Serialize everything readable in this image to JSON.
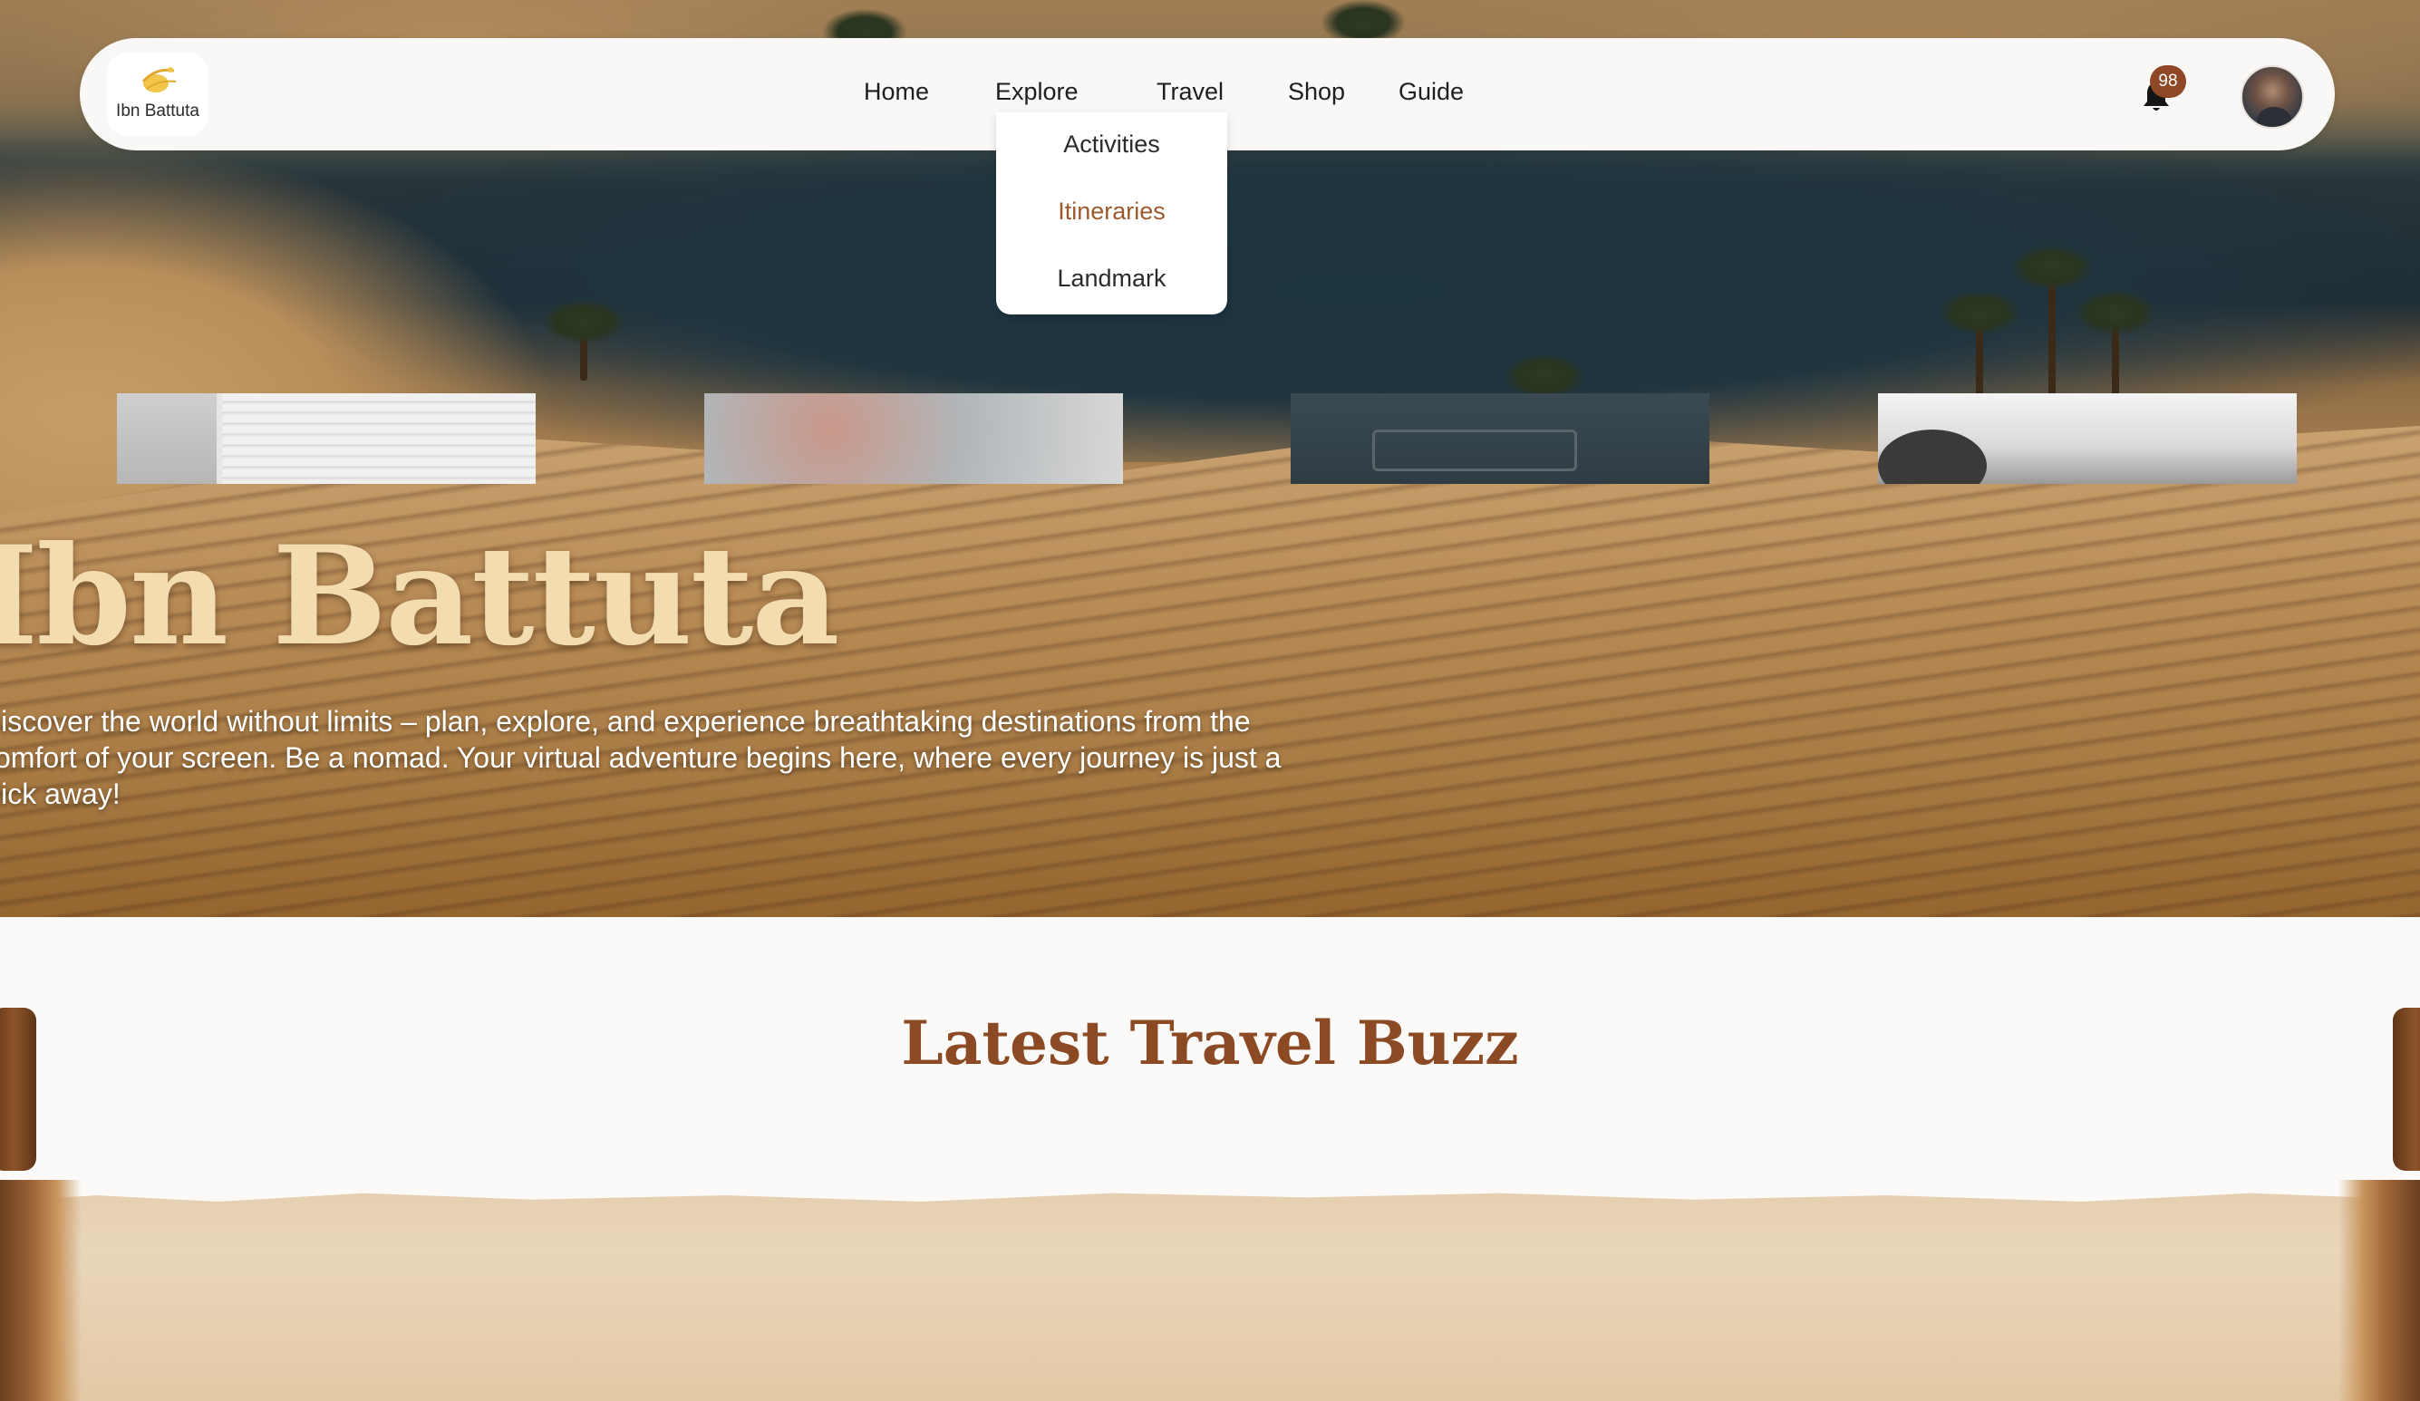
{
  "brand": {
    "name": "Ibn Battuta"
  },
  "nav": {
    "items": [
      {
        "label": "Home"
      },
      {
        "label": "Explore"
      },
      {
        "label": "Travel"
      },
      {
        "label": "Shop"
      },
      {
        "label": "Guide"
      }
    ],
    "dropdown": {
      "items": [
        {
          "label": "Activities"
        },
        {
          "label": "Itineraries",
          "active": true
        },
        {
          "label": "Landmark"
        }
      ]
    },
    "notifications": {
      "count": "98"
    }
  },
  "hero": {
    "title": "Ibn Battuta",
    "text": "Discover the world without limits – plan, explore, and experience breathtaking destinations from the comfort of your screen. Be a nomad. Your virtual adventure begins here, where every journey is just a click away!"
  },
  "latest": {
    "title": "Latest Travel Buzz"
  },
  "colors": {
    "accent": "#8c4a24",
    "active_link": "#9c5a2c",
    "badge": "#8f4726",
    "hero_title": "#f3dcb0",
    "navbar_bg": "#faf8f6"
  },
  "icons": [
    "ibn-battuta-logo-icon",
    "bell-icon",
    "user-avatar"
  ]
}
